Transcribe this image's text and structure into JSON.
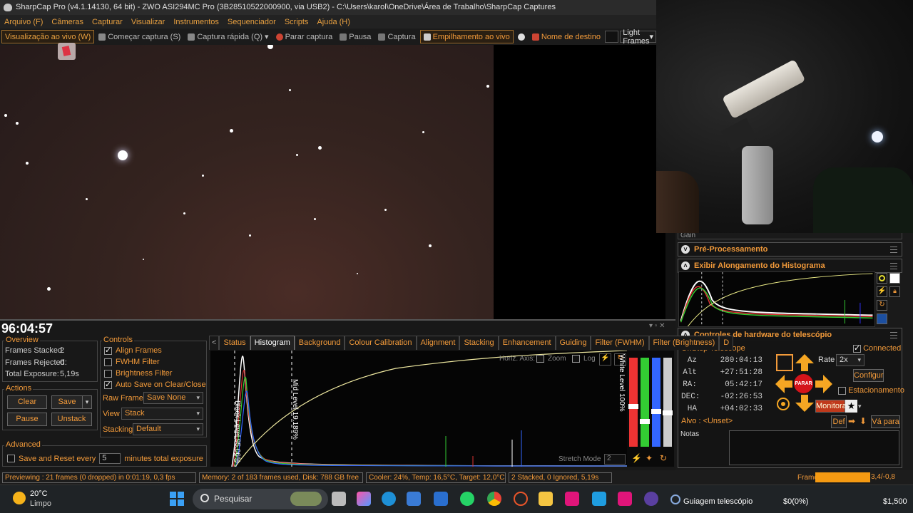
{
  "window": {
    "title": "SharpCap Pro (v4.1.14130, 64 bit) - ZWO ASI294MC Pro (3B28510522000900, via USB2) - C:\\Users\\karol\\OneDrive\\Área de Trabalho\\SharpCap Captures"
  },
  "menu": [
    "Arquivo (F)",
    "Câmeras",
    "Capturar",
    "Visualizar",
    "Instrumentos",
    "Sequenciador",
    "Scripts",
    "Ajuda (H)"
  ],
  "toolbar": {
    "live_view": "Visualização ao vivo (W)",
    "start_capture": "Começar captura (S)",
    "quick_capture": "Captura rápida (Q)",
    "stop_capture": "Parar captura",
    "pause": "Pausa",
    "capture": "Captura",
    "live_stack": "Empilhamento ao vivo",
    "target_name": "Nome de destino",
    "frame_type": "Light Frames"
  },
  "right_panel": {
    "gain_label": "Gain",
    "preprocessing": "Pré-Processamento",
    "histogram_stretch": "Exibir Alongamento do Histograma",
    "telescope_controls": "Controles de hardware do telescópio",
    "telescope_name": "OnStep Telescope",
    "connected": "Connected",
    "coords": [
      {
        "k": "Az",
        "v": "280:04:13"
      },
      {
        "k": "Alt",
        "v": "+27:51:28"
      },
      {
        "k": "RA:",
        "v": "05:42:17"
      },
      {
        "k": "DEC:",
        "v": "-02:26:53"
      },
      {
        "k": "HA",
        "v": "+04:02:33"
      }
    ],
    "rate_label": "Rate",
    "rate_value": "2x",
    "stop_label": "PARAR",
    "configure": "Configur",
    "parking": "Estacionamento",
    "monitor": "Monitora",
    "target_label": "Alvo : <Unset>",
    "def_button": "Def",
    "goto_button": "Vá para",
    "notes_label": "Notas"
  },
  "dock": {
    "timer": "96:04:57",
    "overview": {
      "title": "Overview",
      "frames_stacked_label": "Frames Stacked:",
      "frames_stacked": "2",
      "frames_rejected_label": "Frames Rejected:",
      "frames_rejected": "0",
      "total_exposure_label": "Total Exposure:",
      "total_exposure": "5,19s"
    },
    "actions": {
      "title": "Actions",
      "clear": "Clear",
      "save": "Save",
      "pause": "Pause",
      "unstack": "Unstack"
    },
    "advanced": {
      "title": "Advanced",
      "save_reset_label": "Save and Reset every",
      "save_reset_value": "5",
      "save_reset_unit": "minutes total exposure"
    },
    "controls": {
      "title": "Controls",
      "align_frames": "Align Frames",
      "fwhm_filter": "FWHM Filter",
      "brightness_filter": "Brightness Filter",
      "auto_save": "Auto Save on Clear/Close",
      "raw_frames_label": "Raw Frames",
      "raw_frames_value": "Save None",
      "view_label": "View",
      "view_value": "Stack",
      "stacking_label": "Stacking",
      "stacking_value": "Default"
    },
    "tabs": [
      "Status",
      "Histogram",
      "Background",
      "Colour Calibration",
      "Alignment",
      "Stacking",
      "Enhancement",
      "Guiding",
      "Filter (FWHM)",
      "Filter (Brightness)",
      "D"
    ],
    "histogram": {
      "horiz_axis": "Horiz. Axis:",
      "zoom": "Zoom",
      "log": "Log",
      "black_level": "Black Level 95.06%",
      "mid_level": "Mid Level 19.189%",
      "white_level": "White Level 100%",
      "stretch_mode": "Stretch Mode",
      "stretch_value": "2"
    }
  },
  "status": {
    "previewing": "Previewing : 21 frames (0 dropped) in 0:01:19, 0,3 fps",
    "memory": "Memory: 2 of 183 frames used, Disk: 788 GB free",
    "cooler": "Cooler: 24%, Temp: 16,5°C, Target: 12,0°C",
    "stacked": "2 Stacked, 0 Ignored, 5,19s",
    "frame_label": "Frame :",
    "frame_value": "3,4/-0,8"
  },
  "taskbar": {
    "temp": "20°C",
    "weather": "Limpo",
    "search": "Pesquisar",
    "guiding_label": "Guiagem telescópio",
    "money1": "$0(0%)",
    "money2": "$1,500"
  },
  "colors": {
    "accent": "#f29a3a",
    "stop_red": "#d4141a",
    "frame_bar": "#f59a12"
  }
}
